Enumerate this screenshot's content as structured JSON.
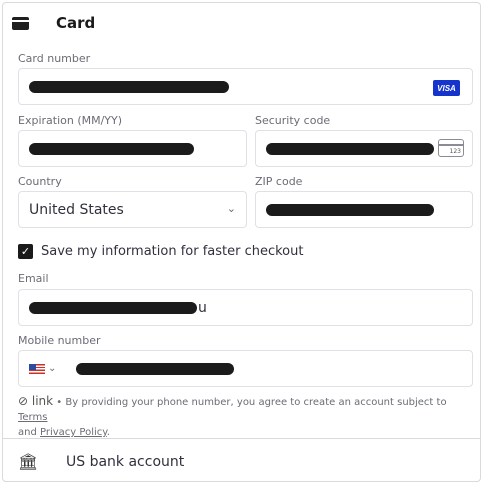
{
  "card_section": {
    "title": "Card",
    "icon": "credit-card-icon"
  },
  "card_number": {
    "label": "Card number",
    "brand": "VISA"
  },
  "expiration": {
    "label": "Expiration (MM/YY)"
  },
  "security_code": {
    "label": "Security code",
    "icon_text": "123"
  },
  "country": {
    "label": "Country",
    "value": "United States"
  },
  "zip": {
    "label": "ZIP code"
  },
  "save_info": {
    "label": "Save my information for faster checkout",
    "checked": true
  },
  "email": {
    "label": "Email",
    "visible_suffix": "u"
  },
  "mobile": {
    "label": "Mobile number"
  },
  "legal": {
    "logo": "link",
    "text": "• By providing your phone number, you agree to create an account subject to",
    "terms": "Terms",
    "and": "and",
    "privacy": "Privacy Policy",
    "period": "."
  },
  "bank": {
    "label": "US bank account",
    "icon": "bank-icon"
  },
  "colors": {
    "visa_blue": "#1434cb",
    "text": "#30313d",
    "muted": "#6b6c75",
    "border": "#e0e0e6"
  }
}
